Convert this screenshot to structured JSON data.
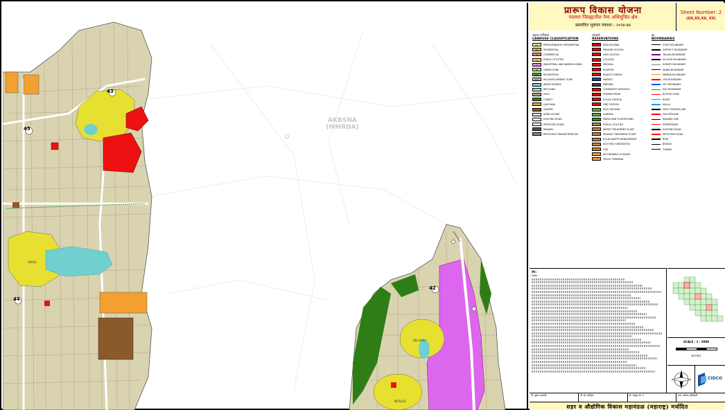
{
  "title": "प्रारूप विकास योजना",
  "subtitle": "पालघर जिल्ह्यातील नैना अधिसूचित क्षेत्र",
  "subtitle2": "प्रस्तावित भूवापर नकाशा - २०२४-४४",
  "sheet": {
    "label": "Sheet Number: 2",
    "code": "(XX,XX,XX, XX)"
  },
  "map": {
    "area_label_1": "AKBSNA",
    "area_label_2": "(MMRDA)",
    "village_numbers": [
      "45",
      "43",
      "44",
      "42"
    ],
    "village_names": [
      "VAVLE",
      "BELAVALI",
      "NITALGE"
    ]
  },
  "legend": {
    "col1_heading": "भूवापर वर्गीकरण",
    "col1_sub": "LANDUSE CLASSIFICATION",
    "col2_heading": "आरक्षणे",
    "col2_sub": "RESERVATIONS",
    "col3_heading": "हद्द",
    "col3_sub": "BOUNDARIES",
    "landuse": [
      {
        "code": "R1",
        "label": "PREDOMINANTLY RESIDENTIAL",
        "color": "#ffff80"
      },
      {
        "code": "R2",
        "label": "RESIDENTIAL",
        "color": "#e0c850"
      },
      {
        "code": "C",
        "label": "COMMERCIAL",
        "color": "#f08080"
      },
      {
        "code": "U",
        "label": "PUBLIC UTILITIES",
        "color": "#ffd050"
      },
      {
        "code": "I",
        "label": "INDUSTRIAL AND WAREHOUSING",
        "color": "#e080f0"
      },
      {
        "code": "G",
        "label": "GREEN ZONE",
        "color": "#b0d880"
      },
      {
        "code": "REC",
        "label": "RECREATION",
        "color": "#60b040"
      },
      {
        "code": "NDZ",
        "label": "NO DEVELOPMENT ZONE",
        "color": "#d8d0b0"
      },
      {
        "code": "",
        "label": "WATER BODIES",
        "color": "#80d0d8"
      },
      {
        "code": "",
        "label": "WETLAND",
        "color": "#a0e0e0"
      },
      {
        "code": "",
        "label": "HILLS",
        "color": "#c0a070"
      },
      {
        "code": "",
        "label": "FOREST",
        "color": "#2e8b22"
      },
      {
        "code": "",
        "label": "GAOTHAN",
        "color": "#f4a030"
      },
      {
        "code": "",
        "label": "QUARRY",
        "color": "#8b5a2b"
      },
      {
        "code": "",
        "label": "AGRICULTURE",
        "color": "#e8e4c8"
      },
      {
        "code": "",
        "label": "EXISTING ROAD",
        "color": "#ffffff"
      },
      {
        "code": "",
        "label": "PROPOSED ROAD",
        "color": "#f0f0f0"
      },
      {
        "code": "",
        "label": "RAILWAY",
        "color": "#555555"
      },
      {
        "code": "",
        "label": "PROPOSED TRANSPORTATION",
        "color": "#888888"
      }
    ],
    "reservations": [
      {
        "label": "EDUCATIONAL",
        "color": "#ff0000"
      },
      {
        "label": "PRIMARY SCHOOL",
        "color": "#ff0000"
      },
      {
        "label": "HIGH SCHOOL",
        "color": "#ff0000"
      },
      {
        "label": "COLLEGE",
        "color": "#ff0000"
      },
      {
        "label": "MEDICAL",
        "color": "#ff0000"
      },
      {
        "label": "HOSPITAL",
        "color": "#ff0000"
      },
      {
        "label": "HEALTH CENTRE",
        "color": "#ff0000"
      },
      {
        "label": "MARKET",
        "color": "#0050a0"
      },
      {
        "label": "PARKING",
        "color": "#404040"
      },
      {
        "label": "COMMUNITY SERVICES",
        "color": "#ff0000"
      },
      {
        "label": "CREMATORIUM",
        "color": "#ff0000"
      },
      {
        "label": "POLICE STATION",
        "color": "#ff0000"
      },
      {
        "label": "FIRE STATION",
        "color": "#ff0000"
      },
      {
        "label": "PLAY GROUND",
        "color": "#60b040"
      },
      {
        "label": "GARDEN",
        "color": "#60b040"
      },
      {
        "label": "PARKS AND PLAYGROUND",
        "color": "#2e8b22"
      },
      {
        "label": "PUBLIC UTILITIES",
        "color": "#c08040"
      },
      {
        "label": "WATER TREATMENT PLANT",
        "color": "#c08040"
      },
      {
        "label": "SEWAGE TREATMENT PLANT",
        "color": "#c08040"
      },
      {
        "label": "SOLID WASTE MANAGEMENT",
        "color": "#c08040"
      },
      {
        "label": "ELECTRIC SUBSTATION",
        "color": "#c08040"
      },
      {
        "label": "GAS",
        "color": "#c08040"
      },
      {
        "label": "AFFORDABLE HOUSING",
        "color": "#f4a030"
      },
      {
        "label": "TRUCK TERMINAL",
        "color": "#f4a030"
      }
    ],
    "boundaries": [
      {
        "label": "STATE BOUNDARY",
        "color": "#000000"
      },
      {
        "label": "DISTRICT BOUNDARY",
        "color": "#000000"
      },
      {
        "label": "TALUKA BOUNDARY",
        "color": "#800080"
      },
      {
        "label": "VILLAGE BOUNDARY",
        "color": "#000000"
      },
      {
        "label": "SURVEY BOUNDARY",
        "color": "#808080"
      },
      {
        "label": "NAINA BOUNDARY",
        "color": "#000000"
      },
      {
        "label": "MMRDA BOUNDARY",
        "color": "#ff8c00"
      },
      {
        "label": "CRZ BOUNDARY",
        "color": "#ff0000"
      },
      {
        "label": "HFL BOUNDARY",
        "color": "#0050ff"
      },
      {
        "label": "ESZ BOUNDARY",
        "color": "#00a000"
      },
      {
        "label": "BUFFER ZONE",
        "color": "#ff0000"
      },
      {
        "label": "RIVER",
        "color": "#00a0ff"
      },
      {
        "label": "NALLA",
        "color": "#00a0ff"
      },
      {
        "label": "HIGH TENSION LINE",
        "color": "#000000"
      },
      {
        "label": "GAS PIPELINE",
        "color": "#ff0000"
      },
      {
        "label": "RAILWAY LINE",
        "color": "#000000"
      },
      {
        "label": "EXPRESSWAY",
        "color": "#ff0000"
      },
      {
        "label": "EXISTING ROAD",
        "color": "#000000"
      },
      {
        "label": "PROPOSED ROAD",
        "color": "#ff0000"
      },
      {
        "label": "ROW",
        "color": "#000000"
      },
      {
        "label": "BRIDGE",
        "color": "#000000"
      },
      {
        "label": "TUNNEL",
        "color": "#000000"
      }
    ]
  },
  "notes_heading": "टीप:",
  "notes_sub": "Note",
  "scale": "SCALE - 1 : 5000",
  "scale_units": "METRES",
  "cidco": "CIDCO",
  "signatures": [
    "पी. दुबल पाटवारी",
    "पी. सो. डेंगांहेल",
    "डॉ. अशुता वो. टे.",
    "प्रफ. लोकस अधिकारी"
  ],
  "footer": "शहर व औद्योगिक विकास महामंडळ (महाराष्ट्र) मर्यादित",
  "colors": {
    "accent": "#8b0000",
    "header_bg": "#fff8c0",
    "land": "#d9d3b0",
    "yellow": "#e8e030",
    "red": "#ee1111",
    "purple": "#dd66ee",
    "cyan": "#70d0d0",
    "forest": "#2f7d16"
  }
}
